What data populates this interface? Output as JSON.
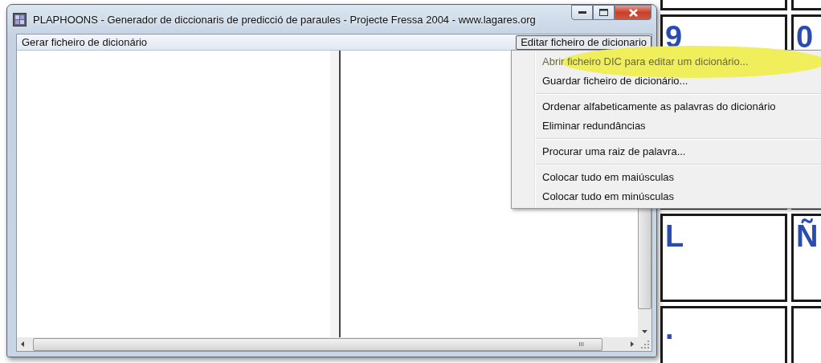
{
  "window": {
    "title": "PLAPHOONS - Generador de diccionaris de predicció de paraules - Projecte Fressa 2004 - www.lagares.org"
  },
  "menu_bar": [
    {
      "label": "Gerar ficheiro de dicionário",
      "selected": false
    },
    {
      "label": "Editar ficheiro de dicionario",
      "selected": true
    }
  ],
  "dropdown": [
    {
      "kind": "item",
      "label": "Abrir ficheiro DIC para editar um dicionário...",
      "highlighted": true
    },
    {
      "kind": "item",
      "label": "Guardar ficheiro de dicionário...",
      "highlighted": false
    },
    {
      "kind": "separator"
    },
    {
      "kind": "item",
      "label": "Ordenar alfabeticamente as palavras do dicionário",
      "highlighted": false
    },
    {
      "kind": "item",
      "label": "Eliminar redundâncias",
      "highlighted": false
    },
    {
      "kind": "separator"
    },
    {
      "kind": "item",
      "label": "Procurar uma raiz de palavra...",
      "highlighted": false
    },
    {
      "kind": "separator"
    },
    {
      "kind": "item",
      "label": "Colocar tudo em maiúsculas",
      "highlighted": false
    },
    {
      "kind": "item",
      "label": "Colocar tudo em minúsculas",
      "highlighted": false
    }
  ],
  "background_cards": [
    {
      "kind": "blank"
    },
    {
      "kind": "blank"
    },
    {
      "kind": "letter",
      "label": "9"
    },
    {
      "kind": "letter",
      "label": "0"
    },
    {
      "kind": "letter",
      "label": "L"
    },
    {
      "kind": "letter",
      "label": "Ñ"
    },
    {
      "kind": "letter",
      "label": "."
    },
    {
      "kind": "blank"
    }
  ],
  "scrollbar_grip": "III"
}
